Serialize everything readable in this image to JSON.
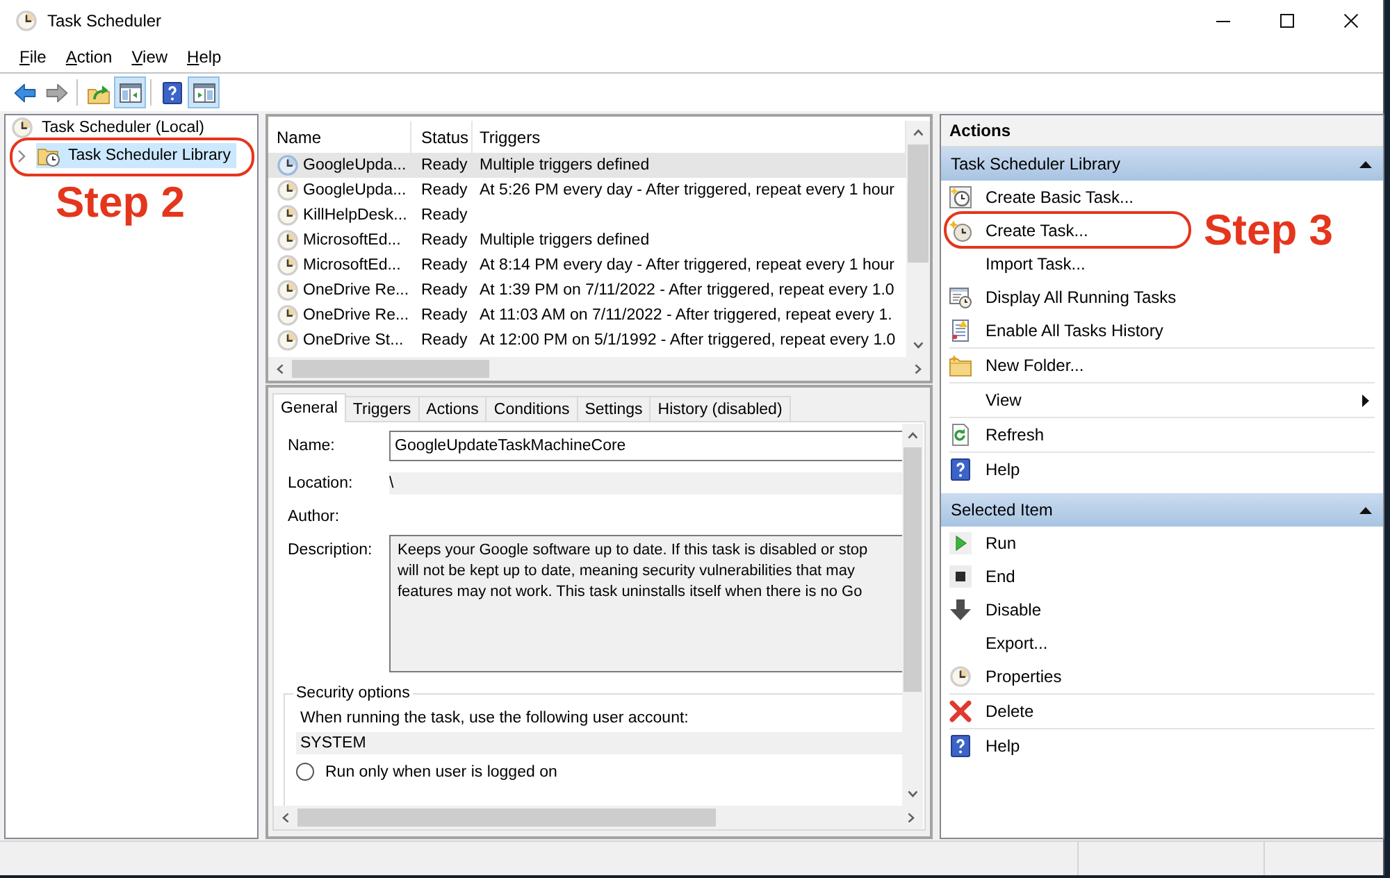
{
  "window": {
    "title": "Task Scheduler"
  },
  "menu": [
    "File",
    "Action",
    "View",
    "Help"
  ],
  "toolbar": [
    {
      "kind": "back",
      "disabled": false,
      "pressed": false
    },
    {
      "kind": "forward",
      "disabled": true,
      "pressed": false
    },
    {
      "kind": "separator"
    },
    {
      "kind": "up",
      "disabled": false,
      "pressed": false
    },
    {
      "kind": "tree",
      "disabled": false,
      "pressed": true
    },
    {
      "kind": "separator"
    },
    {
      "kind": "help",
      "disabled": false,
      "pressed": false
    },
    {
      "kind": "pane",
      "disabled": false,
      "pressed": true
    }
  ],
  "tree": [
    {
      "label": "Task Scheduler (Local)",
      "selected": false,
      "children": [
        {
          "label": "Task Scheduler Library",
          "selected": true,
          "expanded": false,
          "callout": "Step 2"
        }
      ]
    }
  ],
  "task_list": {
    "columns": [
      "Name",
      "Status",
      "Triggers"
    ],
    "rows": [
      {
        "cells": [
          "GoogleUpda...",
          "Ready",
          "Multiple triggers defined"
        ],
        "selected": true
      },
      {
        "cells": [
          "GoogleUpda...",
          "Ready",
          "At 5:26 PM every day - After triggered, repeat every 1 hour"
        ],
        "selected": false
      },
      {
        "cells": [
          "KillHelpDesk...",
          "Ready"
        ],
        "selected": false
      },
      {
        "cells": [
          "MicrosoftEd...",
          "Ready",
          "Multiple triggers defined"
        ],
        "selected": false
      },
      {
        "cells": [
          "MicrosoftEd...",
          "Ready",
          "At 8:14 PM every day - After triggered, repeat every 1 hour"
        ],
        "selected": false
      },
      {
        "cells": [
          "OneDrive Re...",
          "Ready",
          "At 1:39 PM on 7/11/2022 - After triggered, repeat every 1.0"
        ],
        "selected": false
      },
      {
        "cells": [
          "OneDrive Re...",
          "Ready",
          "At 11:03 AM on 7/11/2022 - After triggered, repeat every 1."
        ],
        "selected": false
      },
      {
        "cells": [
          "OneDrive St...",
          "Ready",
          "At 12:00 PM on 5/1/1992 - After triggered, repeat every 1.0"
        ],
        "selected": false
      }
    ]
  },
  "details": {
    "tabs": [
      {
        "label": "General",
        "selected": true
      },
      {
        "label": "Triggers",
        "selected": false
      },
      {
        "label": "Actions",
        "selected": false
      },
      {
        "label": "Conditions",
        "selected": false
      },
      {
        "label": "Settings",
        "selected": false
      },
      {
        "label": "History (disabled)",
        "selected": false
      }
    ],
    "fields": [
      {
        "label": "Name:",
        "kind": "input",
        "value": "GoogleUpdateTaskMachineCore"
      },
      {
        "label": "Location:",
        "kind": "readonly",
        "value": "\\"
      },
      {
        "label": "Author:",
        "kind": "plain"
      },
      {
        "label": "Description:",
        "kind": "textarea",
        "value": "Keeps your Google software up to date. If this task is disabled or stop\nwill not be kept up to date, meaning security vulnerabilities that may\nfeatures may not work. This task uninstalls itself when there is no Go"
      }
    ],
    "security": {
      "title": "Security options",
      "account_label": "When running the task, use the following user account:",
      "account": "SYSTEM",
      "options": [
        {
          "label": "Run only when user is logged on",
          "selected": false
        }
      ]
    }
  },
  "actions": {
    "title": "Actions",
    "sections": [
      {
        "title": "Task Scheduler Library",
        "expanded": true,
        "groups": [
          [
            {
              "label": "Create Basic Task...",
              "kind": "wizard"
            },
            {
              "label": "Create Task...",
              "kind": "task",
              "callout": "Step 3"
            },
            {
              "label": "Import Task...",
              "kind": "plain"
            },
            {
              "label": "Display All Running Tasks",
              "kind": "running"
            },
            {
              "label": "Enable All Tasks History",
              "kind": "history"
            }
          ],
          [
            {
              "label": "New Folder...",
              "kind": "folder"
            }
          ],
          [
            {
              "label": "View",
              "kind": "submenu"
            }
          ],
          [
            {
              "label": "Refresh",
              "kind": "refresh"
            }
          ],
          [
            {
              "label": "Help",
              "kind": "help"
            }
          ]
        ]
      },
      {
        "title": "Selected Item",
        "expanded": true,
        "groups": [
          [
            {
              "label": "Run",
              "kind": "run"
            },
            {
              "label": "End",
              "kind": "end"
            },
            {
              "label": "Disable",
              "kind": "disable"
            },
            {
              "label": "Export...",
              "kind": "plain"
            },
            {
              "label": "Properties",
              "kind": "properties"
            }
          ],
          [
            {
              "label": "Delete",
              "kind": "delete"
            }
          ],
          [
            {
              "label": "Help",
              "kind": "help"
            }
          ]
        ]
      }
    ]
  }
}
